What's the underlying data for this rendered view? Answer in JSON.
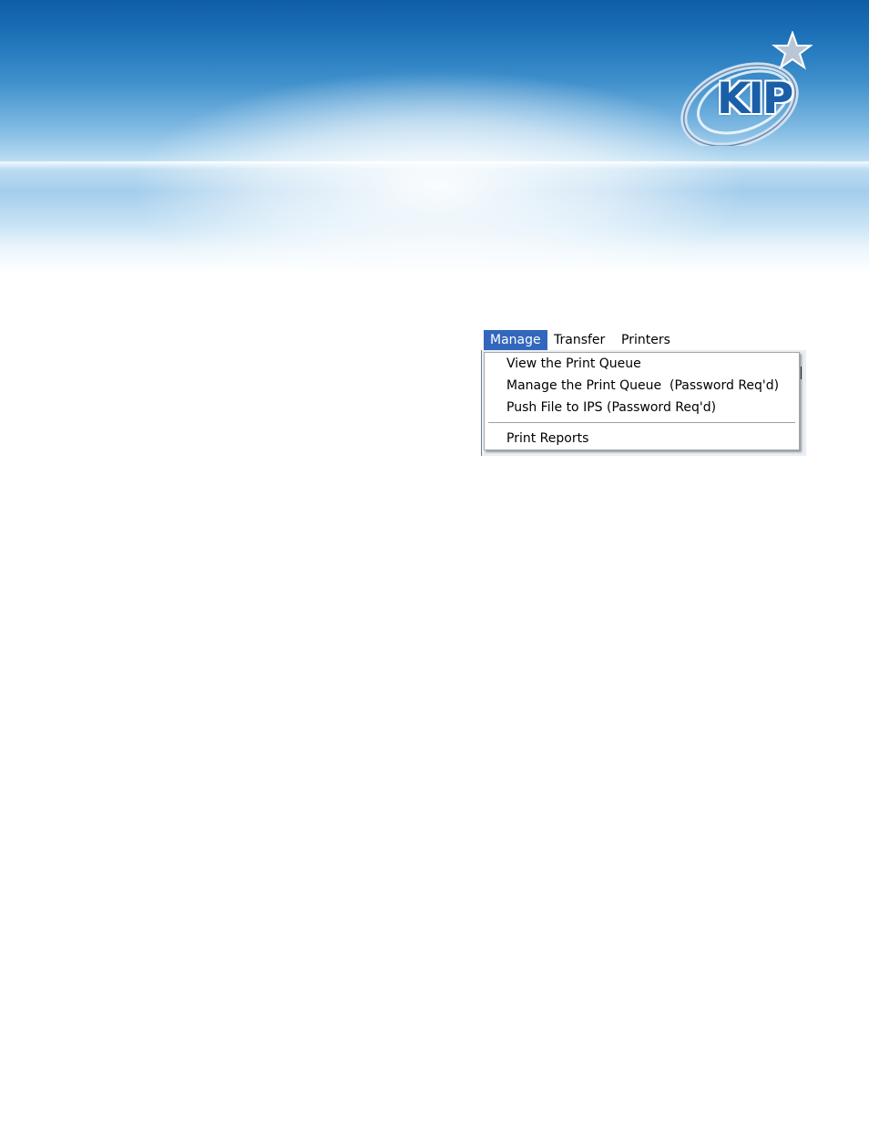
{
  "header": {
    "logo_text": "KIP",
    "logo_icon": "kip-star-logo-icon",
    "colors": {
      "band_top": "#0f5da5",
      "band_light": "#b9dcf2",
      "logo_blue": "#1b5fa8"
    }
  },
  "menubar": {
    "items": [
      {
        "label": "Manage",
        "active": true
      },
      {
        "label": "Transfer",
        "active": false
      },
      {
        "label": "Printers",
        "active": false
      }
    ],
    "active_color": "#3267bd"
  },
  "dropdown": {
    "items": [
      {
        "label": "View the Print Queue"
      },
      {
        "label": "Manage the Print Queue  (Password Req'd)"
      },
      {
        "label": "Push File to IPS (Password Req'd)"
      },
      {
        "label": "Print Reports"
      }
    ]
  }
}
